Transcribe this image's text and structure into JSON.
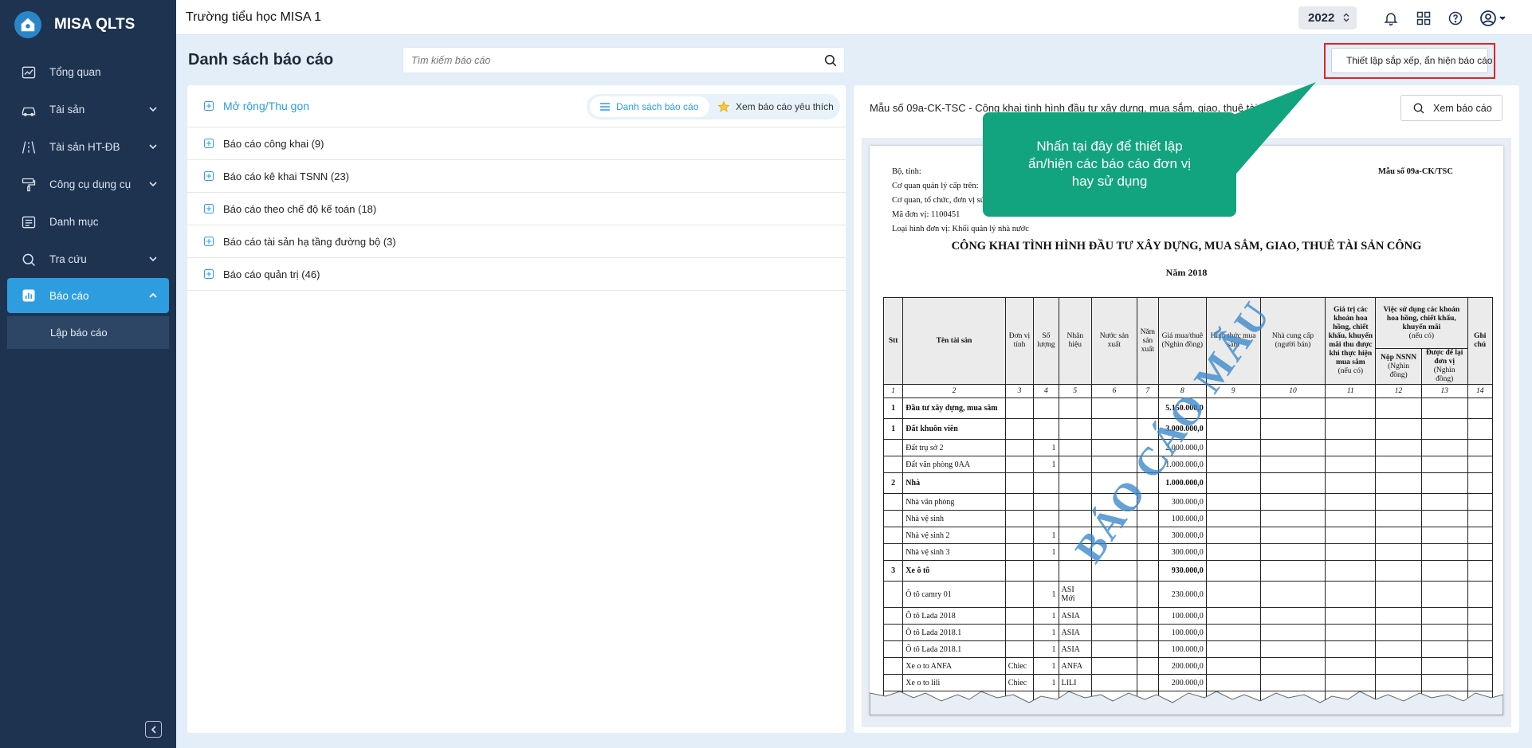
{
  "app": {
    "name": "MISA QLTS",
    "school": "Trường tiểu học MISA 1",
    "year": "2022"
  },
  "sidebar": {
    "items": [
      {
        "label": "Tổng quan",
        "icon": "chart-line-icon",
        "has_children": false
      },
      {
        "label": "Tài sản",
        "icon": "car-icon",
        "has_children": true
      },
      {
        "label": "Tài sản HT-ĐB",
        "icon": "road-icon",
        "has_children": true
      },
      {
        "label": "Công cụ dụng cụ",
        "icon": "paint-roller-icon",
        "has_children": true
      },
      {
        "label": "Danh mục",
        "icon": "list-icon",
        "has_children": false
      },
      {
        "label": "Tra cứu",
        "icon": "search-icon",
        "has_children": true
      },
      {
        "label": "Báo cáo",
        "icon": "bar-chart-icon",
        "has_children": true,
        "active": true
      }
    ],
    "sub_item": "Lập báo cáo"
  },
  "page": {
    "title": "Danh sách báo cáo",
    "search_placeholder": "Tìm kiếm báo cáo"
  },
  "toolbar": {
    "settings_label": "Thiết lập sắp xếp, ẩn hiện báo cáo"
  },
  "left_panel": {
    "expand_label": "Mở rộng/Thu gọn",
    "tab_list": "Danh sách báo cáo",
    "tab_fav": "Xem báo cáo yêu thích",
    "groups": [
      "Báo cáo công khai (9)",
      "Báo cáo kê khai TSNN (23)",
      "Báo cáo theo chế độ kế toán (18)",
      "Báo cáo tài sản hạ tầng đường bộ (3)",
      "Báo cáo quản trị (46)"
    ]
  },
  "right_panel": {
    "title": "Mẫu số 09a-CK-TSC - Công khai tình hình đầu tư xây dựng, mua sắm, giao, thuê tài sản công",
    "view_label": "Xem báo cáo"
  },
  "callout": {
    "line1": "Nhấn tại đây để thiết lập",
    "line2": "ẩn/hiện các báo cáo đơn vị",
    "line3": "hay sử dụng"
  },
  "report": {
    "h1": "Bộ, tỉnh:",
    "h2": "Cơ quan quản lý cấp trên:",
    "h3": "Cơ quan, tổ chức, đơn vị sử dụng",
    "h4": "Mã đơn vị: 1100451",
    "h5": "Loại hình đơn vị: Khối quản lý nhà nước",
    "form_no": "Mẫu số 09a-CK/TSC",
    "title": "CÔNG KHAI TÌNH HÌNH ĐẦU TƯ XÂY DỰNG, MUA SẮM, GIAO, THUÊ TÀI SẢN CÔNG",
    "year": "Năm 2018",
    "watermark": "BÁO CÁO MẪU",
    "headers": {
      "stt": "Stt",
      "name": "Tên tài sản",
      "unit": "Đơn vị tính",
      "qty": "Số lượng",
      "brand": "Nhãn hiệu",
      "country": "Nước sản xuất",
      "year": "Năm sản xuất",
      "price": "Giá mua/thuê",
      "price_unit": "(Nghìn đồng)",
      "form": "Hình thức mua sắm",
      "supplier": "Nhà cung cấp",
      "supplier_sub": "(người bán)",
      "discount": "Giá trị các khoản hoa hồng, chiết khấu, khuyến mãi thu được khi thực hiện mua sắm",
      "discount_sub": "(nếu có)",
      "usage": "Việc sử dụng các khoản hoa hồng, chiết khấu, khuyến mãi",
      "usage_sub": "(nếu có)",
      "nsnn": "Nộp NSNN",
      "nsnn_sub": "(Nghìn đồng)",
      "kept": "Được để lại đơn vị",
      "kept_sub": "(Nghìn đồng)",
      "note": "Ghi chú"
    },
    "col_numbers": [
      "1",
      "2",
      "3",
      "4",
      "5",
      "6",
      "7",
      "8",
      "9",
      "10",
      "11",
      "12",
      "13",
      "14"
    ],
    "rows": [
      {
        "stt": "1",
        "name": "Đầu tư xây dựng, mua sắm",
        "unit": "",
        "qty": "",
        "brand": "",
        "price": "5.150.000,0",
        "bold": true
      },
      {
        "stt": "1",
        "name": "Đất khuôn viên",
        "unit": "",
        "qty": "",
        "brand": "",
        "price": "3.000.000,0",
        "bold": true
      },
      {
        "stt": "",
        "name": "Đất trụ sở 2",
        "unit": "",
        "qty": "1",
        "brand": "",
        "price": "2.000.000,0"
      },
      {
        "stt": "",
        "name": "Đất văn phòng 0AA",
        "unit": "",
        "qty": "1",
        "brand": "",
        "price": "1.000.000,0"
      },
      {
        "stt": "2",
        "name": "Nhà",
        "unit": "",
        "qty": "",
        "brand": "",
        "price": "1.000.000,0",
        "bold": true
      },
      {
        "stt": "",
        "name": "Nhà văn phòng",
        "unit": "",
        "qty": "",
        "brand": "",
        "price": "300.000,0"
      },
      {
        "stt": "",
        "name": "Nhà vệ sinh",
        "unit": "",
        "qty": "",
        "brand": "",
        "price": "100.000,0"
      },
      {
        "stt": "",
        "name": "Nhà vệ sinh 2",
        "unit": "",
        "qty": "1",
        "brand": "",
        "price": "300.000,0"
      },
      {
        "stt": "",
        "name": "Nhà vệ sinh 3",
        "unit": "",
        "qty": "1",
        "brand": "",
        "price": "300.000,0"
      },
      {
        "stt": "3",
        "name": "Xe ô tô",
        "unit": "",
        "qty": "",
        "brand": "",
        "price": "930.000,0",
        "bold": true
      },
      {
        "stt": "",
        "name": "Ô tô camry 01",
        "unit": "",
        "qty": "1",
        "brand": "ASI Mới",
        "price": "230.000,0",
        "tall": true
      },
      {
        "stt": "",
        "name": "Ô tô Lada 2018",
        "unit": "",
        "qty": "1",
        "brand": "ASIA",
        "price": "100.000,0"
      },
      {
        "stt": "",
        "name": "Ô tô Lada 2018.1",
        "unit": "",
        "qty": "1",
        "brand": "ASIA",
        "price": "100.000,0"
      },
      {
        "stt": "",
        "name": "Ô tô Lada 2018.1",
        "unit": "",
        "qty": "1",
        "brand": "ASIA",
        "price": "100.000,0"
      },
      {
        "stt": "",
        "name": "Xe o to ANFA",
        "unit": "Chiec",
        "qty": "1",
        "brand": "ANFA",
        "price": "200.000,0"
      },
      {
        "stt": "",
        "name": "Xe o to lili",
        "unit": "Chiec",
        "qty": "1",
        "brand": "LILI",
        "price": "200.000,0"
      },
      {
        "stt": "",
        "name": "",
        "unit": "",
        "qty": "",
        "brand": "",
        "price": ""
      }
    ]
  },
  "colors": {
    "sidebar": "#1e3350",
    "accent": "#2d9de0",
    "callout": "#12a47e",
    "highlight": "#e02424"
  }
}
